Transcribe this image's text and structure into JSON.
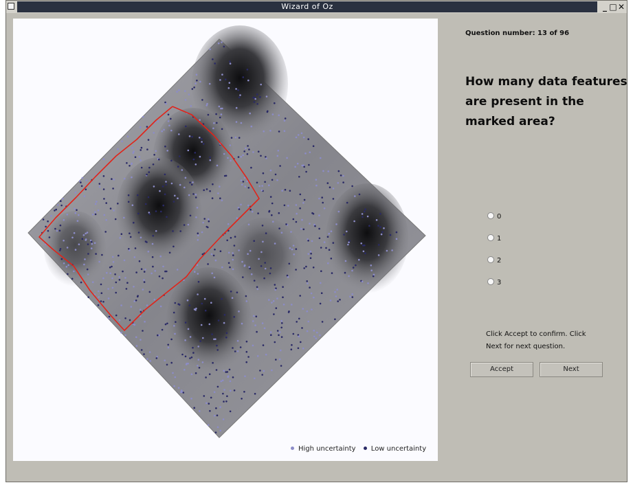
{
  "window": {
    "title": "Wizard of Oz",
    "controls": [
      "_",
      "□",
      "✕"
    ]
  },
  "visualization": {
    "legend": [
      {
        "label": "High uncertainty",
        "color": "#8c8cc8"
      },
      {
        "label": "Low uncertainty",
        "color": "#2a2a66"
      }
    ],
    "marked_area_color": "#e0241a"
  },
  "panel": {
    "question_number": "Question number: 13 of 96",
    "question": "How many data features are present in the marked area?",
    "options": [
      "0",
      "1",
      "2",
      "3"
    ],
    "instructions": "Click Accept to confirm. Click Next for next question.",
    "accept_label": "Accept",
    "next_label": "Next"
  }
}
